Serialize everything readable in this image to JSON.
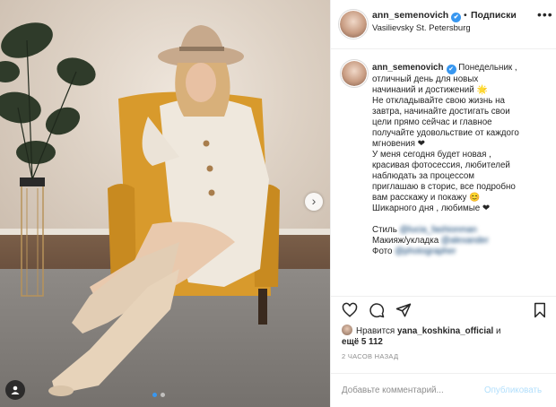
{
  "header": {
    "username": "ann_semenovich",
    "separator": "•",
    "follow_label": "Подписки",
    "location": "Vasilievsky St. Petersburg",
    "more_icon": "more-horizontal-icon"
  },
  "caption": {
    "username": "ann_semenovich",
    "lines": [
      "Понедельник ,",
      "отличный день для новых",
      "начинаний и достижений 🌟",
      "Не откладывайте свою жизнь на",
      "завтра, начинайте достигать свои",
      "цели прямо сейчас и главное",
      "получайте удовольствие от каждого",
      "мгновения ❤",
      "У меня сегодня будет новая ,",
      "красивая фотосессия, любителей",
      "наблюдать за процессом",
      "приглашаю в сторис, все подробно",
      "вам расскажу и покажу 😊",
      "Шикарного дня , любимые ❤"
    ],
    "credits": [
      {
        "prefix": "Стиль ",
        "handle": "@lucia_fashionman"
      },
      {
        "prefix": "Макияж/укладка ",
        "handle": "@alexander"
      },
      {
        "prefix": "Фото ",
        "handle": "@photographer"
      }
    ]
  },
  "actions": {
    "like_icon": "heart-icon",
    "comment_icon": "comment-icon",
    "share_icon": "share-icon",
    "save_icon": "bookmark-icon"
  },
  "likes": {
    "prefix": "Нравится",
    "user": "yana_koshkina_official",
    "joiner": "и",
    "others": "ещё 5 112"
  },
  "time": "2 часов назад",
  "comment": {
    "placeholder": "Добавьте комментарий...",
    "publish_label": "Опубликовать"
  },
  "colors": {
    "accent": "#3897f0",
    "publish_disabled": "#b2dffc",
    "border": "#efefef",
    "muted_text": "#8e8e8e"
  }
}
